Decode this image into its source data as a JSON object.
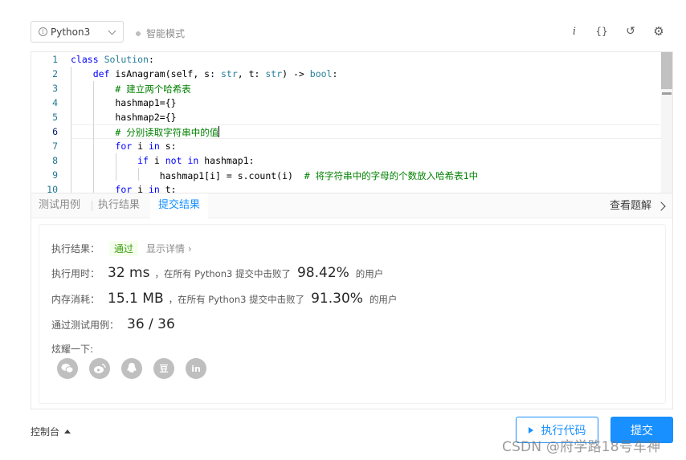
{
  "toolbar": {
    "language": "Python3",
    "mode_label": "智能模式",
    "icons": [
      "info-italic-icon",
      "braces-icon",
      "reset-icon",
      "settings-icon"
    ],
    "info_glyph": "i",
    "braces_glyph": "{}",
    "reset_glyph": "↺",
    "settings_glyph": "⚙"
  },
  "editor": {
    "line_numbers": [
      "1",
      "2",
      "3",
      "4",
      "5",
      "6",
      "7",
      "8",
      "9",
      "10"
    ],
    "lines": [
      "class Solution:",
      "    def isAnagram(self, s: str, t: str) -> bool:",
      "        # 建立两个哈希表",
      "        hashmap1={}",
      "        hashmap2={}",
      "        # 分别读取字符串中的值",
      "        for i in s:",
      "            if i not in hashmap1:",
      "                hashmap1[i] = s.count(i)  # 将字符串中的字母的个数放入哈希表1中",
      "        for i in t:"
    ]
  },
  "tabs": [
    {
      "label": "测试用例"
    },
    {
      "label": "执行结果"
    },
    {
      "label": "提交结果"
    }
  ],
  "view_solution": "查看题解",
  "result": {
    "status_label": "执行结果：",
    "status_value": "通过",
    "details_link": "显示详情",
    "details_chevron": "›",
    "runtime_label": "执行用时：",
    "runtime_value": "32 ms",
    "runtime_text": "，在所有 Python3 提交中击败了",
    "runtime_percent": "98.42%",
    "runtime_suffix": "的用户",
    "memory_label": "内存消耗：",
    "memory_value": "15.1 MB",
    "memory_text": "，在所有 Python3 提交中击败了",
    "memory_percent": "91.30%",
    "memory_suffix": "的用户",
    "cases_label": "通过测试用例：",
    "cases_value": "36 / 36",
    "share_label": "炫耀一下:",
    "share_icons": [
      "wechat-icon",
      "weibo-icon",
      "qq-icon",
      "douban-icon",
      "linkedin-icon"
    ],
    "douban_glyph": "豆",
    "linkedin_glyph": "in"
  },
  "bottom": {
    "console_label": "控制台",
    "run_label": "执行代码",
    "submit_label": "提交"
  },
  "watermark": "CSDN @府学路18号车神",
  "colors": {
    "accent": "#1890ff",
    "pass": "#389e0d"
  }
}
